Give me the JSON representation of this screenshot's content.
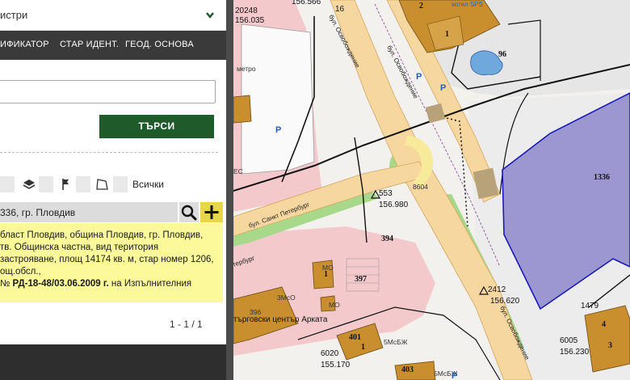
{
  "panel": {
    "layer_select": {
      "value": "истри"
    },
    "tabs": [
      "ИФИКАТОР",
      "СТАР ИДЕНТ.",
      "ГЕОД. ОСНОВА"
    ],
    "search_button": "ТЪРСИ",
    "filters_all_label": "Всички",
    "result": {
      "title": "336, гр. Пловдив"
    },
    "info_lines": [
      "бласт Пловдив, община Пловдив, гр. Пловдив,",
      "тв. Общинска частна, вид територия",
      "застрояване, площ 14174 кв. м, стар номер 1206,",
      "ощ.обсл.,"
    ],
    "info_last": {
      "prefix": "№ ",
      "order": "РД-18-48/03.06.2009 г.",
      "suffix": " на Изпълнителния"
    },
    "pager": "1 - 1 / 1"
  },
  "map": {
    "labels": {
      "l20248": "20248",
      "l156035": "156.035",
      "l156566": "156.566",
      "l16": "16",
      "hotel": "хотел SPS",
      "l96": "96",
      "metro": "метро",
      "s_osv1": "бул. Освобождение",
      "s_osv2": "бул. Освобождение",
      "s_osv3": "бул. Освобождение",
      "s_pet1": "бул. Санкт Петербург",
      "s_pet2": "тербург",
      "l1336": "1336",
      "l553": "553",
      "l156980": "156.980",
      "l8604": "8604",
      "l394": "394",
      "l397": "397",
      "l2412": "2412",
      "l156620": "156.620",
      "l1479": "1479",
      "l396": "396",
      "trade": "търговски център Арката",
      "l401": "401",
      "l403": "403",
      "l6020": "6020",
      "l155170": "155.170",
      "l6005": "6005",
      "l156230": "156.230",
      "mo1": "МО",
      "mo2": "МО",
      "m3mo": "3МсО",
      "m5a": "5МсБЖ",
      "m5b": "5МсБЖ",
      "ec": "ЕС",
      "parking": "P",
      "unit1": "1",
      "unit2": "2",
      "unit3": "3",
      "unit4": "4"
    }
  },
  "colors": {
    "dark_green": "#1f5a2b",
    "tab_bar": "#3a3a3a",
    "info_bg": "#fbf99a",
    "add_btn": "#e8d64a",
    "parcel_fill": "#8a84c9",
    "road": "#f7d7a0",
    "building": "#c98f2e"
  }
}
